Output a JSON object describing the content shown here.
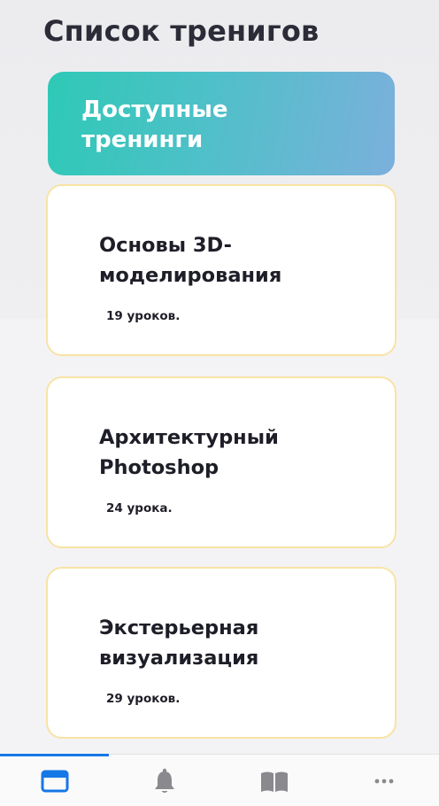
{
  "header": {
    "title": "Список тренигов"
  },
  "banner": {
    "title": "Доступные тренинги"
  },
  "trainings": [
    {
      "title": "Основы 3D-моделирования",
      "lessons": "19 уроков."
    },
    {
      "title": "Архитектурный Photoshop",
      "lessons": "24 урока."
    },
    {
      "title": "Экстерьерная визуализация",
      "lessons": "29 уроков."
    }
  ],
  "tabbar": {
    "tabs": [
      {
        "icon": "browser-window-icon",
        "active": true
      },
      {
        "icon": "bell-icon",
        "active": false
      },
      {
        "icon": "book-icon",
        "active": false
      },
      {
        "icon": "more-dots-icon",
        "active": false
      }
    ]
  },
  "colors": {
    "accent": "#1677e6",
    "banner_start": "#2ec9b6",
    "banner_end": "#7bb0dc",
    "card_border": "#f8e3a4",
    "inactive_icon": "#8a8a8e"
  }
}
